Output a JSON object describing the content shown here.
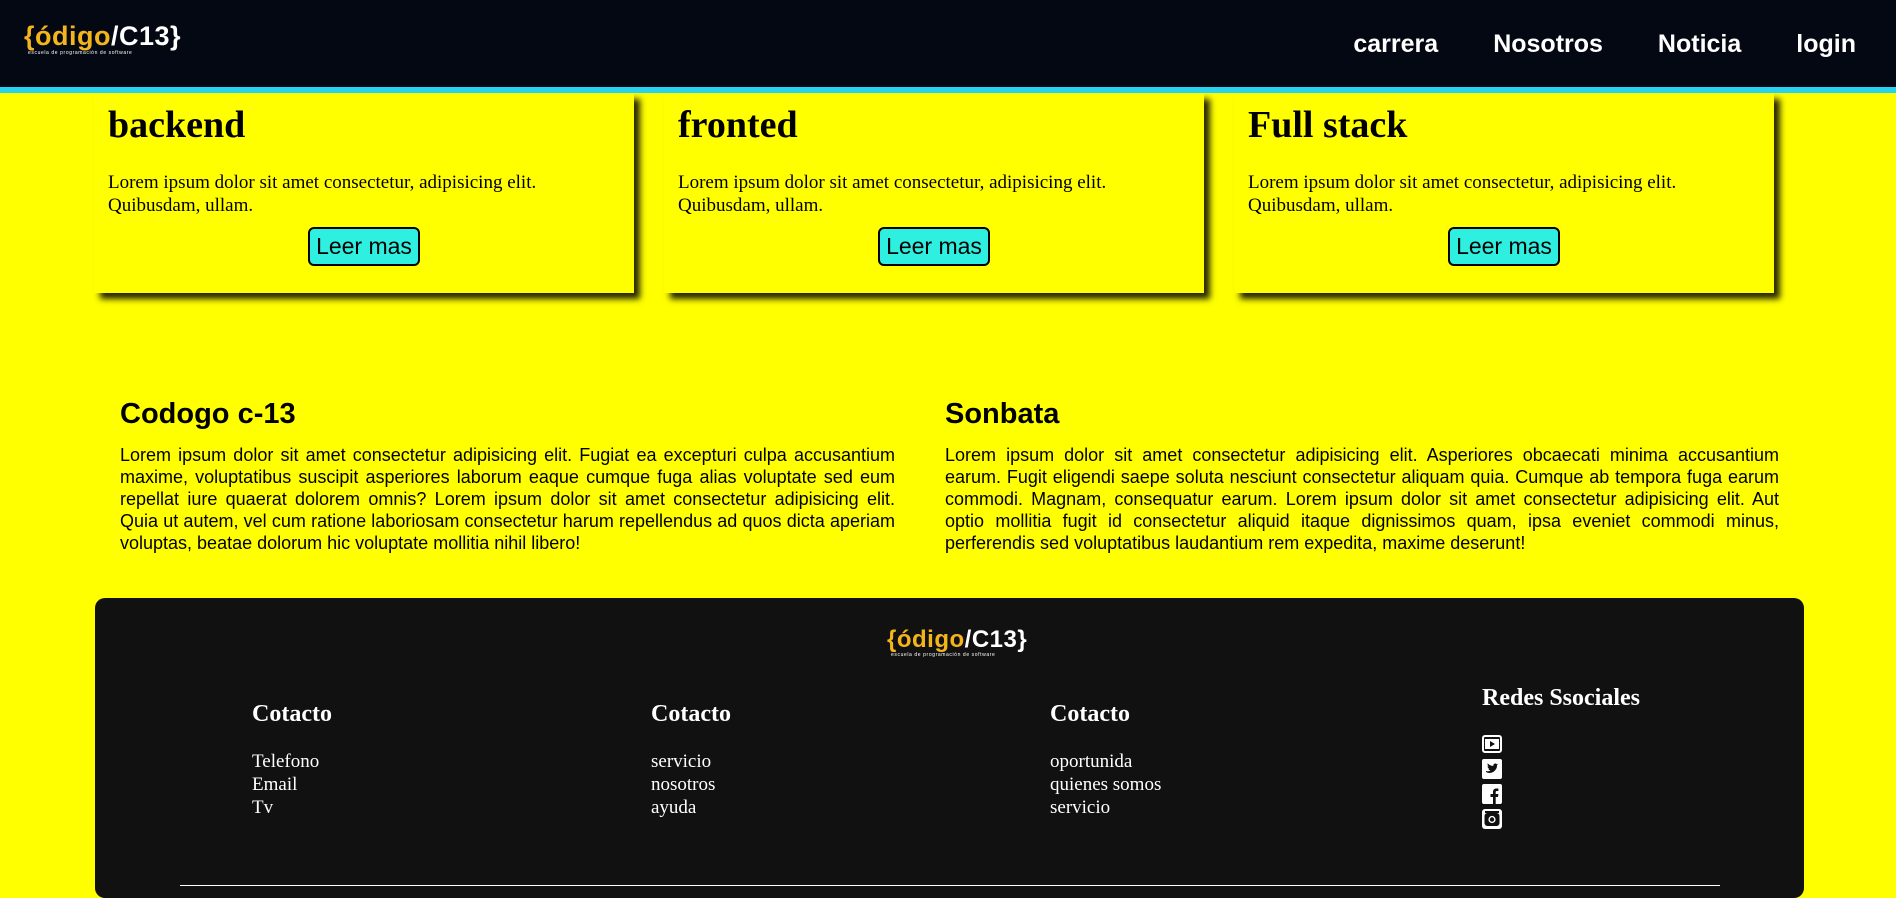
{
  "brand": {
    "logo_main_yellow": "{ódigo",
    "logo_main_white": "/C13}",
    "logo_tagline": "escuela de programación de software",
    "colors": {
      "nav_bg": "#030812",
      "accent": "#27d3f1",
      "page_bg": "#ffff00",
      "button_bg": "#2ff0e0",
      "footer_bg": "#111111",
      "logo_yellow": "#f3b41c"
    }
  },
  "nav": {
    "items": [
      {
        "label": "carrera"
      },
      {
        "label": "Nosotros"
      },
      {
        "label": "Noticia"
      },
      {
        "label": "login"
      }
    ]
  },
  "cards": [
    {
      "title": "backend",
      "text": "Lorem ipsum dolor sit amet consectetur, adipisicing elit. Quibusdam, ullam.",
      "button": "Leer mas"
    },
    {
      "title": "fronted",
      "text": "Lorem ipsum dolor sit amet consectetur, adipisicing elit. Quibusdam, ullam.",
      "button": "Leer mas"
    },
    {
      "title": "Full stack",
      "text": "Lorem ipsum dolor sit amet consectetur, adipisicing elit. Quibusdam, ullam.",
      "button": "Leer mas"
    }
  ],
  "about": [
    {
      "title": "Codogo c-13",
      "text": "Lorem ipsum dolor sit amet consectetur adipisicing elit. Fugiat ea excepturi culpa accusantium maxime, voluptatibus suscipit asperiores laborum eaque cumque fuga alias voluptate sed eum repellat iure quaerat dolorem omnis? Lorem ipsum dolor sit amet consectetur adipisicing elit. Quia ut autem, vel cum ratione laboriosam consectetur harum repellendus ad quos dicta aperiam voluptas, beatae dolorum hic voluptate mollitia nihil libero!"
    },
    {
      "title": "Sonbata",
      "text": "Lorem ipsum dolor sit amet consectetur adipisicing elit. Asperiores obcaecati minima accusantium earum. Fugit eligendi saepe soluta nesciunt consectetur aliquam quia. Cumque ab tempora fuga earum commodi. Magnam, consequatur earum. Lorem ipsum dolor sit amet consectetur adipisicing elit. Aut optio mollitia fugit id consectetur aliquid itaque dignissimos quam, ipsa eveniet commodi minus, perferendis sed voluptatibus laudantium rem expedita, maxime deserunt!"
    }
  ],
  "footer": {
    "columns": [
      {
        "title": "Cotacto",
        "links": [
          "Telefono",
          "Email",
          "Tv"
        ]
      },
      {
        "title": "Cotacto",
        "links": [
          "servicio",
          "nosotros",
          "ayuda"
        ]
      },
      {
        "title": "Cotacto",
        "links": [
          "oportunida",
          "quienes somos",
          "servicio"
        ]
      }
    ],
    "social": {
      "title": "Redes Ssociales",
      "icons": [
        "youtube-icon",
        "twitter-icon",
        "facebook-icon",
        "instagram-icon"
      ]
    }
  }
}
